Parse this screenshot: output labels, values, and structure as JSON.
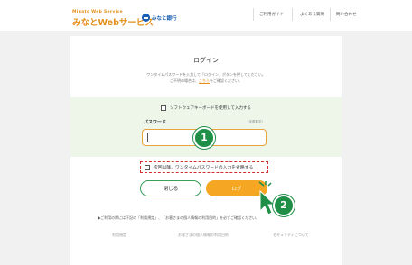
{
  "header": {
    "brand_sub": "Minato Web Service",
    "brand_title": "みなとWebサービス",
    "bank_name": "みなと銀行",
    "nav": [
      "ご利用ガイド",
      "よくある質問",
      "問い合わせ"
    ]
  },
  "login": {
    "title": "ログイン",
    "desc_line1": "ワンタイムパスワードを入力して「ログイン」ボタンを押してください。",
    "desc_line2_pre": "ご不明の場合は、",
    "desc_line2_link": "こちら",
    "desc_line2_post": "をご確認ください。",
    "software_kb_label": "ソフトウェアキーボードを使用して入力する",
    "password_label": "パスワード",
    "password_hint": "（半角数字）",
    "password_value": "",
    "skip_label": "次回以降、ワンタイムパスワードの入力を省略する",
    "close_button": "閉じる",
    "login_button": "ログ",
    "notice": "◆ご利用の際には下記の「利用規定」、「お客さまの個人情報の利用目的」を必ずご確認ください。"
  },
  "footer": {
    "links": [
      "利用規定",
      "お客さまの個人情報の利用目的",
      "セキュリティについて"
    ]
  },
  "annotations": {
    "step1": "1",
    "step2": "2"
  },
  "colors": {
    "brand_orange": "#e38f1a",
    "login_orange": "#f5a623",
    "step_green": "#1f8f47",
    "panel_green": "#eef6ea",
    "close_border": "#39a05a"
  }
}
